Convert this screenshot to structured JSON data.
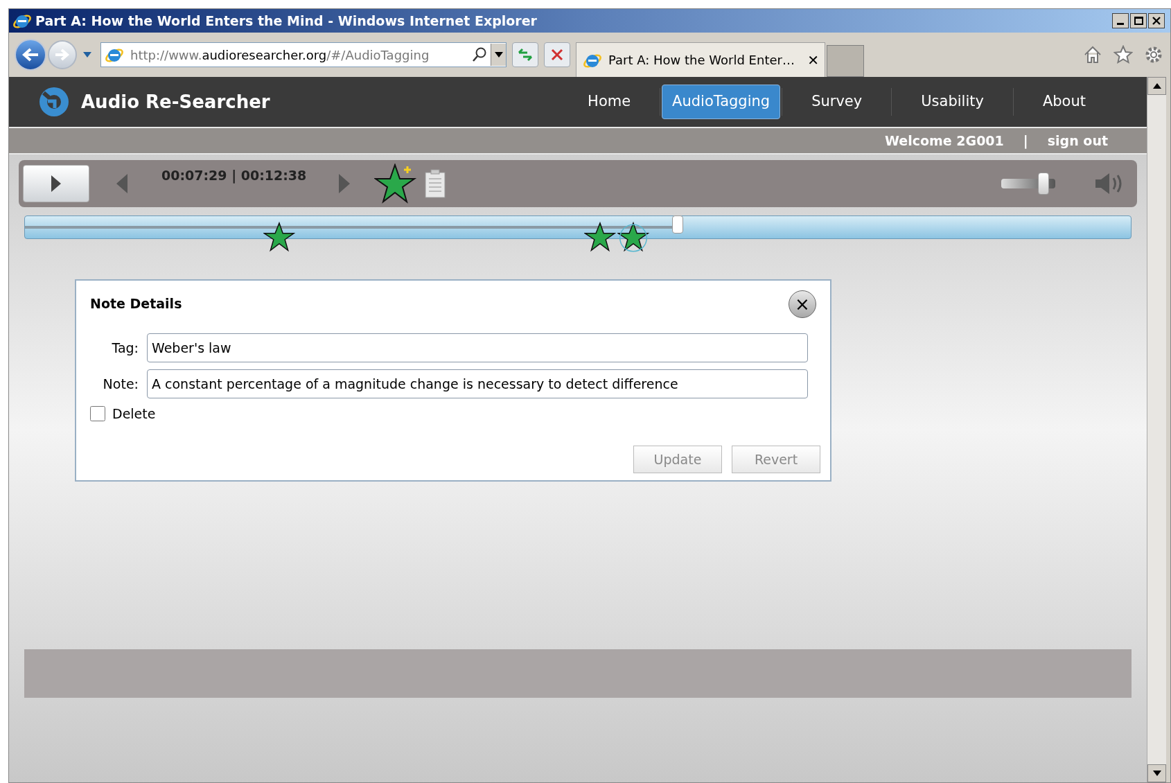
{
  "window": {
    "title": "Part A: How the World Enters the Mind - Windows Internet Explorer"
  },
  "address_bar": {
    "prefix": "http://www.",
    "domain": "audioresearcher.org",
    "path": "/#/AudioTagging"
  },
  "browser_tab": {
    "title": "Part A: How the World Enter…",
    "close": "✕"
  },
  "site": {
    "name": "Audio Re-Searcher"
  },
  "nav": [
    {
      "label": "Home",
      "selected": false
    },
    {
      "label": "AudioTagging",
      "selected": true
    },
    {
      "label": "Survey",
      "selected": false
    },
    {
      "label": "Usability",
      "selected": false
    },
    {
      "label": "About",
      "selected": false
    }
  ],
  "user_bar": {
    "welcome": "Welcome 2G001",
    "separator": "|",
    "sign_out": "sign out"
  },
  "player": {
    "time": "00:07:29 | 00:12:38",
    "volume": {
      "level": 0.88
    },
    "timeline": {
      "level": 0.59,
      "markers": [
        {
          "level": 0.23,
          "selected": false
        },
        {
          "level": 0.52,
          "selected": false
        },
        {
          "level": 0.55,
          "selected": true
        }
      ]
    }
  },
  "note_dialog": {
    "title": "Note Details",
    "close": "×",
    "fields": [
      {
        "label": "Tag:",
        "value": "Weber's law"
      },
      {
        "label": "Note:",
        "value": "A constant percentage of a magnitude change is necessary to detect difference"
      }
    ],
    "delete": {
      "label": "Delete",
      "checked": false
    },
    "buttons": [
      {
        "label": "Update",
        "disabled": true
      },
      {
        "label": "Revert",
        "disabled": true
      }
    ]
  }
}
